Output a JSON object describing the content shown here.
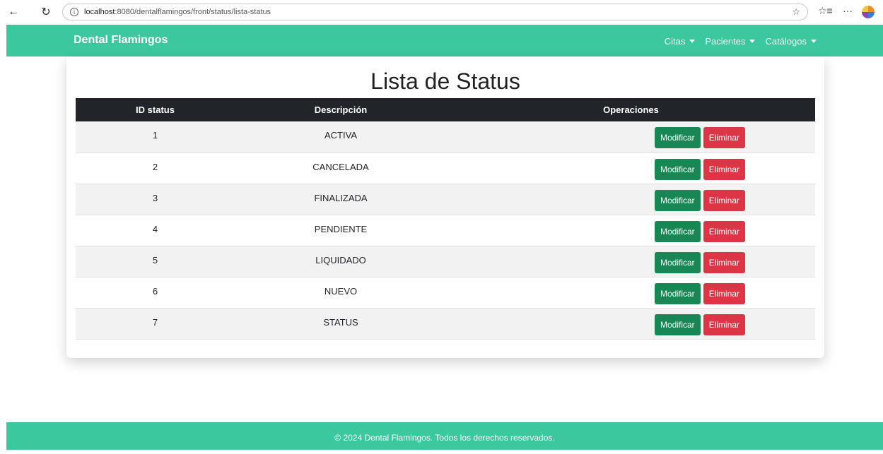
{
  "browser": {
    "url_host": "localhost",
    "url_path": ":8080/dentalflamingos/front/status/lista-status"
  },
  "navbar": {
    "brand": "Dental Flamingos",
    "menu": [
      {
        "label": "Citas"
      },
      {
        "label": "Pacientes"
      },
      {
        "label": "Catálogos"
      }
    ]
  },
  "main": {
    "title": "Lista de Status",
    "table": {
      "headers": [
        "ID status",
        "Descripción",
        "Operaciones"
      ],
      "rows": [
        {
          "id": "1",
          "desc": "ACTIVA"
        },
        {
          "id": "2",
          "desc": "CANCELADA"
        },
        {
          "id": "3",
          "desc": "FINALIZADA"
        },
        {
          "id": "4",
          "desc": "PENDIENTE"
        },
        {
          "id": "5",
          "desc": "LIQUIDADO"
        },
        {
          "id": "6",
          "desc": "NUEVO"
        },
        {
          "id": "7",
          "desc": "STATUS"
        }
      ],
      "modify_label": "Modificar",
      "delete_label": "Eliminar"
    }
  },
  "footer": {
    "text": "© 2024 Dental Flamingos. Todos los derechos reservados."
  },
  "colors": {
    "brand": "#3cc89f",
    "header_dark": "#212529",
    "modify": "#198754",
    "delete": "#dc3545"
  }
}
